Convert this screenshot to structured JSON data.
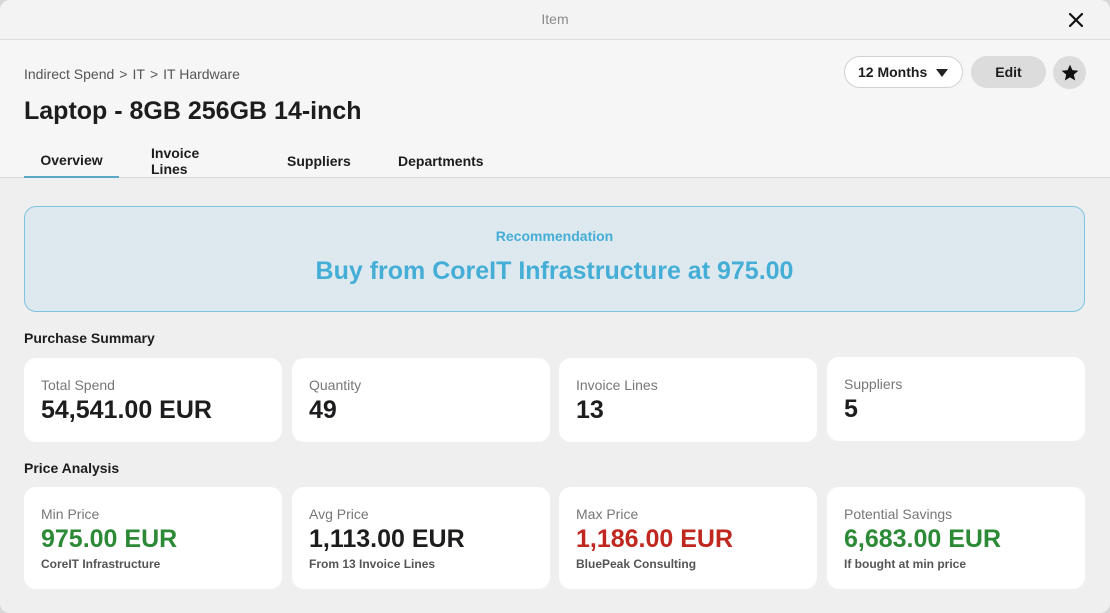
{
  "window": {
    "title": "Item"
  },
  "header": {
    "breadcrumb": [
      "Indirect Spend",
      ">",
      "IT",
      ">",
      "IT Hardware"
    ],
    "title": "Laptop - 8GB 256GB 14-inch",
    "period": "12 Months",
    "edit_label": "Edit"
  },
  "tabs": [
    {
      "label": "Overview",
      "active": true
    },
    {
      "label": "Invoice Lines",
      "active": false
    },
    {
      "label": "Suppliers",
      "active": false
    },
    {
      "label": "Departments",
      "active": false
    }
  ],
  "recommendation": {
    "label": "Recommendation",
    "text": "Buy from CoreIT Infrastructure at 975.00"
  },
  "purchase_summary": {
    "title": "Purchase Summary",
    "cards": [
      {
        "label": "Total Spend",
        "value": "54,541.00 EUR"
      },
      {
        "label": "Quantity",
        "value": "49"
      },
      {
        "label": "Invoice Lines",
        "value": "13"
      },
      {
        "label": "Suppliers",
        "value": "5"
      }
    ]
  },
  "price_analysis": {
    "title": "Price Analysis",
    "cards": [
      {
        "label": "Min Price",
        "value": "975.00 EUR",
        "sub": "CoreIT Infrastructure",
        "color": "#2c8a36"
      },
      {
        "label": "Avg Price",
        "value": "1,113.00 EUR",
        "sub": "From 13 Invoice Lines",
        "color": "#1d1d1f"
      },
      {
        "label": "Max Price",
        "value": "1,186.00 EUR",
        "sub": "BluePeak Consulting",
        "color": "#c0271f"
      },
      {
        "label": "Potential Savings",
        "value": "6,683.00 EUR",
        "sub": "If bought at min price",
        "color": "#2c8a36"
      }
    ]
  },
  "colors": {
    "accent": "#45aed6",
    "positive": "#2c8a36",
    "negative": "#c0271f"
  }
}
